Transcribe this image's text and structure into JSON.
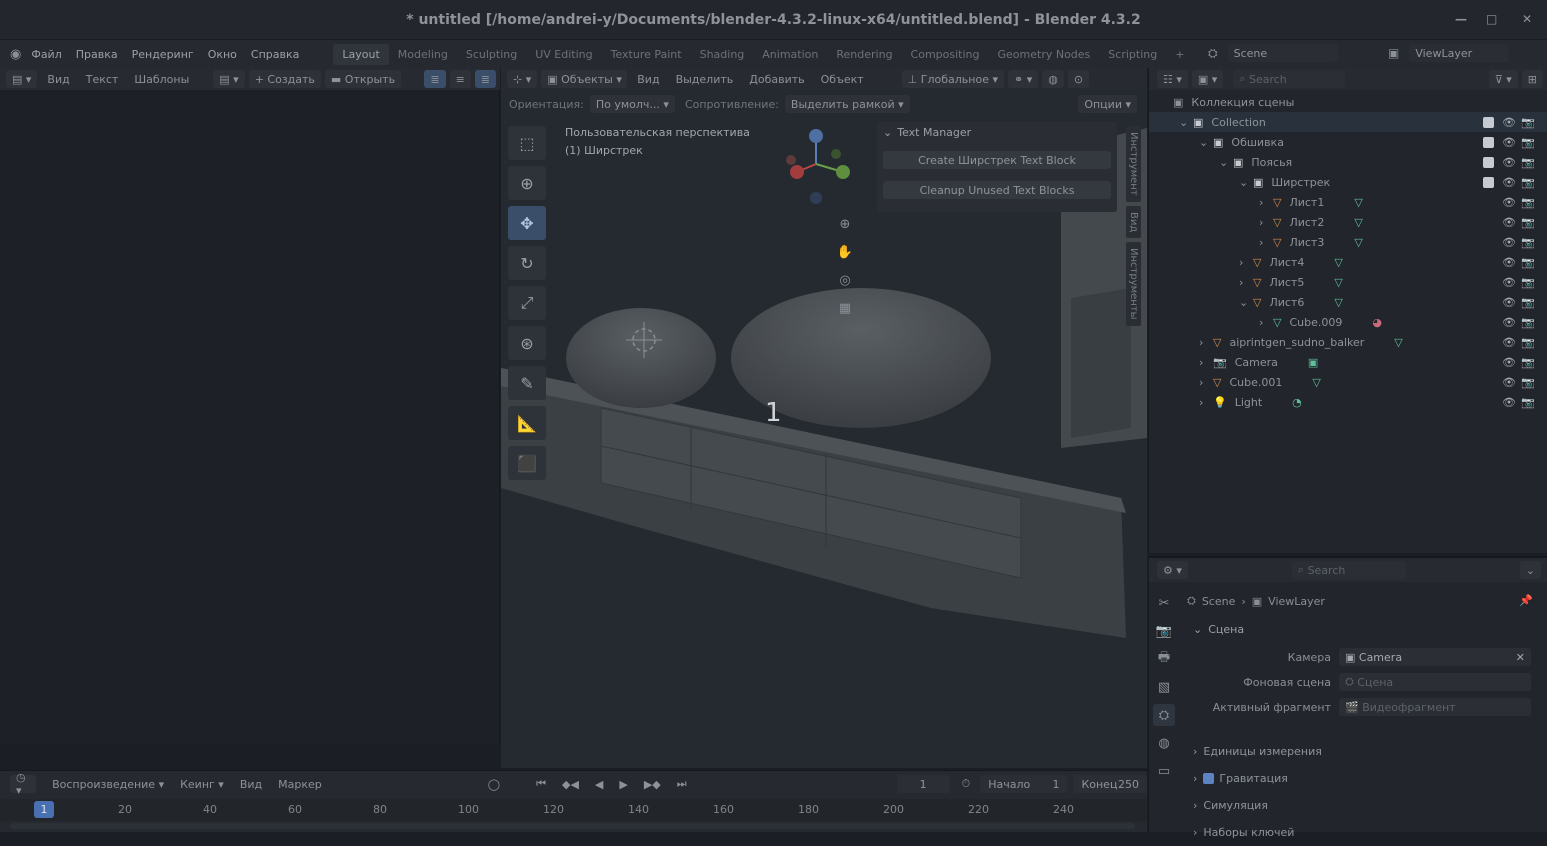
{
  "window": {
    "title": "* untitled [/home/andrei-y/Documents/blender-4.3.2-linux-x64/untitled.blend] - Blender 4.3.2"
  },
  "menubar": {
    "items": [
      "Файл",
      "Правка",
      "Рендеринг",
      "Окно",
      "Справка"
    ],
    "workspaces": [
      "Layout",
      "Modeling",
      "Sculpting",
      "UV Editing",
      "Texture Paint",
      "Shading",
      "Animation",
      "Rendering",
      "Compositing",
      "Geometry Nodes",
      "Scripting"
    ],
    "active_workspace": "Layout",
    "scene": "Scene",
    "view_layer": "ViewLayer"
  },
  "text_editor": {
    "menus": [
      "Вид",
      "Текст",
      "Шаблоны"
    ],
    "new_label": "Создать",
    "open_label": "Открыть"
  },
  "viewport": {
    "mode": "Объекты",
    "menus": [
      "Вид",
      "Выделить",
      "Добавить",
      "Объект"
    ],
    "transform": "Глобальное",
    "orientation_label": "Ориентация:",
    "orientation_value": "По умолч...",
    "snap_label": "Сопротивление:",
    "snap_value": "Выделить рамкой",
    "options_label": "Опции",
    "overlay_line1": "Пользовательская перспектива",
    "overlay_line2": "(1) Ширстрек",
    "center_number": "1",
    "side_tabs": [
      "Инструмент",
      "Вид",
      "Инструменты"
    ],
    "panel": {
      "title": "Text Manager",
      "btn1": "Create Ширстрек Text Block",
      "btn2": "Cleanup Unused Text Blocks"
    },
    "gizmo": {
      "x": "X",
      "y": "Y",
      "z": "Z"
    }
  },
  "outliner": {
    "search_placeholder": "Search",
    "root": "Коллекция сцены",
    "rows": [
      {
        "label": "Collection",
        "indent": 0
      },
      {
        "label": "Обшивка",
        "indent": 1
      },
      {
        "label": "Пояcья",
        "indent": 2
      },
      {
        "label": "Ширстрек",
        "indent": 3
      },
      {
        "label": "Лист1",
        "indent": 4
      },
      {
        "label": "Лист2",
        "indent": 4
      },
      {
        "label": "Лист3",
        "indent": 4
      },
      {
        "label": "Лист4",
        "indent": 3
      },
      {
        "label": "Лист5",
        "indent": 3
      },
      {
        "label": "Лист6",
        "indent": 3
      },
      {
        "label": "Cube.009",
        "indent": 4
      },
      {
        "label": "aiprintgen_sudno_balker",
        "indent": 1
      },
      {
        "label": "Camera",
        "indent": 1
      },
      {
        "label": "Cube.001",
        "indent": 1
      },
      {
        "label": "Light",
        "indent": 1
      }
    ]
  },
  "properties": {
    "search_placeholder": "Search",
    "breadcrumb_scene": "Scene",
    "breadcrumb_layer": "ViewLayer",
    "section_title": "Сцена",
    "camera_label": "Камера",
    "camera_value": "Camera",
    "bg_scene_label": "Фоновая сцена",
    "bg_scene_placeholder": "Сцена",
    "active_clip_label": "Активный фрагмент",
    "active_clip_placeholder": "Видеофрагмент",
    "units": "Единицы измерения",
    "gravity": "Гравитация",
    "simulation": "Симуляция",
    "keying_sets": "Наборы ключей"
  },
  "timeline": {
    "playback": "Воспроизведение",
    "keying": "Кеинг",
    "view": "Вид",
    "marker": "Маркер",
    "current_frame": "1",
    "start_label": "Начало",
    "start_value": "1",
    "end_label": "Конец",
    "end_value": "250",
    "ticks": [
      "20",
      "40",
      "60",
      "80",
      "100",
      "120",
      "140",
      "160",
      "180",
      "200",
      "220",
      "240"
    ],
    "playhead": "1"
  }
}
